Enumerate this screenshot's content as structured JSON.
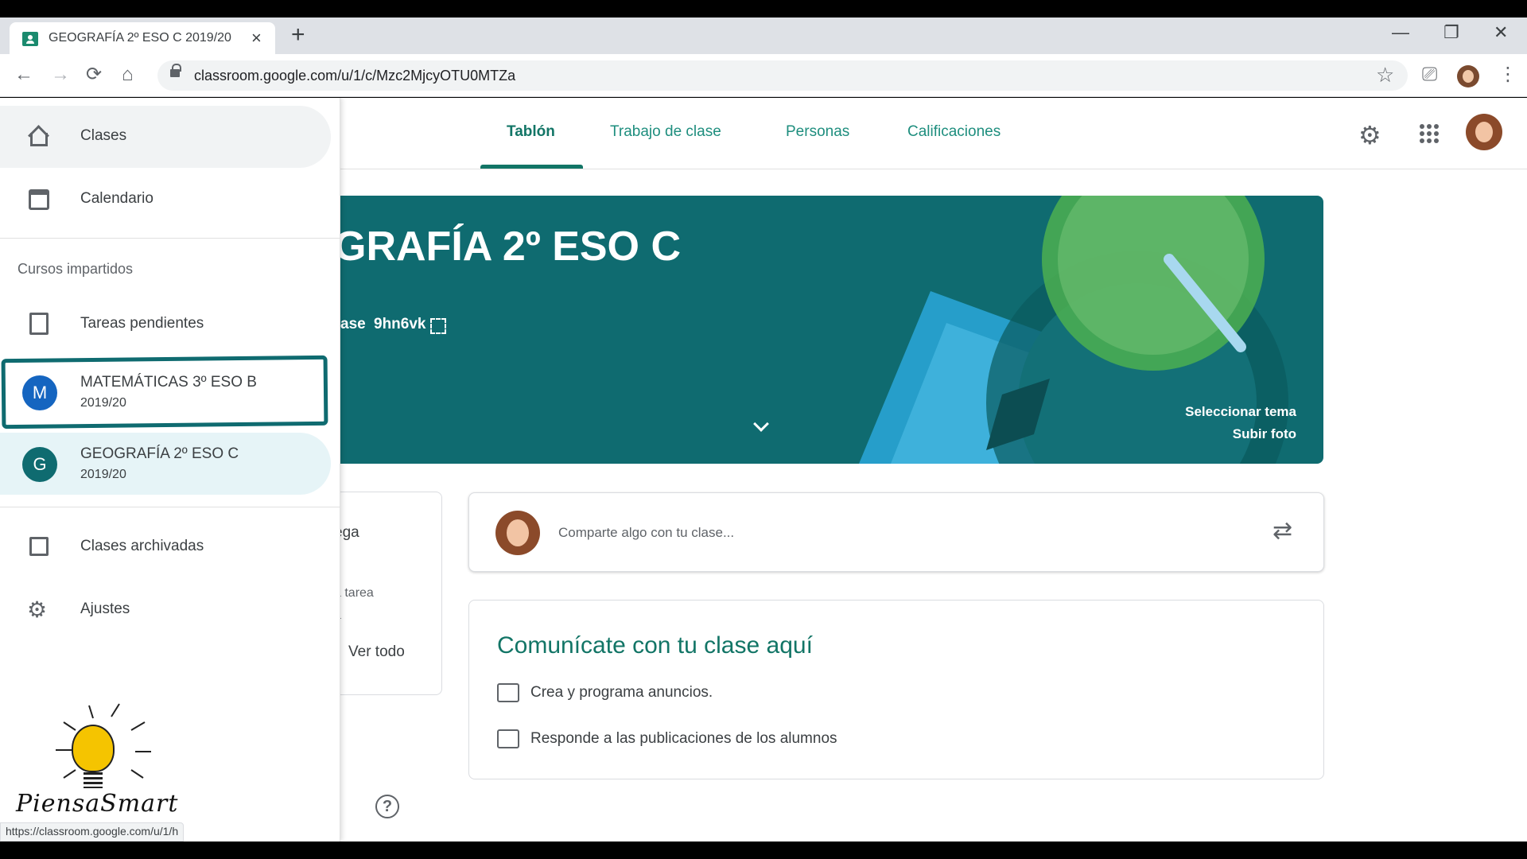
{
  "browser": {
    "tab_title": "GEOGRAFÍA 2º ESO C 2019/20",
    "tab_close": "×",
    "new_tab": "+",
    "url": "classroom.google.com/u/1/c/Mzc2MjcyOTU0MTZa",
    "status_url": "https://classroom.google.com/u/1/h",
    "win_minimize": "—",
    "win_restore": "❐",
    "win_close": "✕"
  },
  "nav": {
    "tabs": [
      {
        "label": "Tablón"
      },
      {
        "label": "Trabajo de clase"
      },
      {
        "label": "Personas"
      },
      {
        "label": "Calificaciones"
      }
    ]
  },
  "banner": {
    "title": "GRAFÍA 2º ESO C",
    "code_label": "ase",
    "code": "9hn6vk",
    "select_theme": "Seleccionar tema",
    "upload_photo": "Subir foto"
  },
  "upcoming": {
    "title": "ega",
    "text_line1": "a tarea",
    "text_line2": "a",
    "view_all": "Ver todo"
  },
  "share": {
    "placeholder": "Comparte algo con tu clase..."
  },
  "communicate": {
    "title": "Comunícate con tu clase aquí",
    "row1": "Crea y programa anuncios.",
    "row2": "Responde a las publicaciones de los alumnos"
  },
  "drawer": {
    "classes": "Clases",
    "calendar": "Calendario",
    "section_heading": "Cursos impartidos",
    "pending": "Tareas pendientes",
    "courses": [
      {
        "initial": "M",
        "name": "MATEMÁTICAS 3º ESO B",
        "year": "2019/20",
        "color": "#1565c0"
      },
      {
        "initial": "G",
        "name": "GEOGRAFÍA 2º ESO C",
        "year": "2019/20",
        "color": "#0f6b70"
      }
    ],
    "archived": "Clases archivadas",
    "settings": "Ajustes"
  },
  "logo": {
    "text": "PiensaSmart"
  },
  "colors": {
    "accent": "#127566",
    "banner": "#0f6b70"
  }
}
